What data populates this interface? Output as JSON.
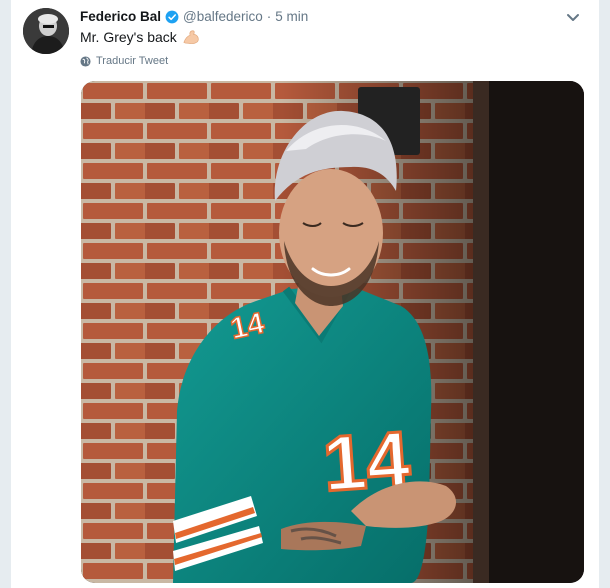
{
  "tweet": {
    "author_name": "Federico Bal",
    "handle": "@balfederico",
    "separator": "·",
    "time": "5 min",
    "text": "Mr. Grey's back",
    "translate_label": "Traducir Tweet",
    "jersey_number": "14",
    "sleeve_number": "14"
  },
  "icons": {
    "verified": "verified-badge-icon",
    "caret": "chevron-down-icon",
    "emoji": "flexed-biceps-emoji",
    "translate": "globe-icon"
  },
  "colors": {
    "background": "#e6ecf0",
    "verified_blue": "#1da1f2",
    "text_primary": "#14171a",
    "text_secondary": "#657786",
    "jersey_teal": "#0a8d86",
    "jersey_orange": "#e4682e"
  }
}
